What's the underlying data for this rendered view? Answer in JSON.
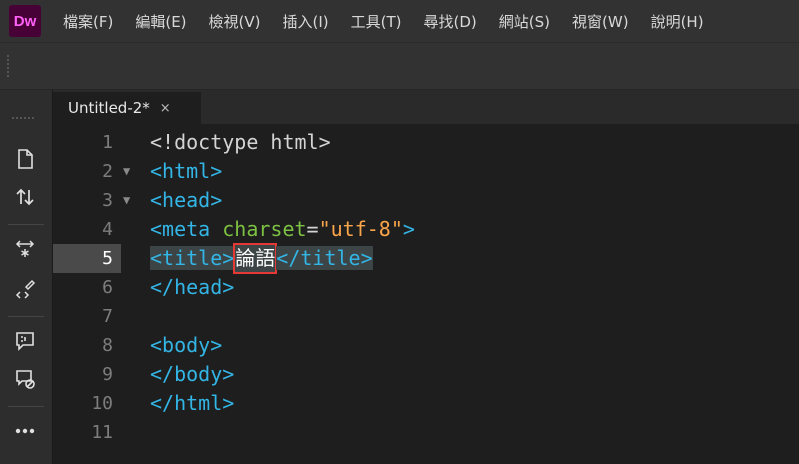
{
  "app": {
    "logo_text": "Dw",
    "logo_bg": "#470137",
    "logo_fg": "#ff61f6"
  },
  "menu": [
    "檔案(F)",
    "編輯(E)",
    "檢視(V)",
    "插入(I)",
    "工具(T)",
    "尋找(D)",
    "網站(S)",
    "視窗(W)",
    "說明(H)"
  ],
  "left_toolbar": {
    "icons": [
      "file-icon",
      "sort-arrows-icon",
      "expand-collapse-icon",
      "format-source-icon",
      "comment-icon",
      "remove-comment-icon",
      "more-icon"
    ]
  },
  "tab": {
    "title": "Untitled-2*",
    "close": "×"
  },
  "editor": {
    "active_line": 5,
    "line_numbers": [
      "1",
      "2",
      "3",
      "4",
      "5",
      "6",
      "7",
      "8",
      "9",
      "10",
      "11"
    ],
    "folds": [
      "",
      "▼",
      "▼",
      "",
      "",
      "",
      "",
      "",
      "",
      "",
      ""
    ],
    "lines": {
      "l1": "<!doctype html>",
      "l2": "<html>",
      "l3": "<head>",
      "l4_tag_open": "<meta ",
      "l4_attr": "charset",
      "l4_eq": "=",
      "l4_val": "\"utf-8\"",
      "l4_tag_close": ">",
      "l5_open": "<title>",
      "l5_text": "論語",
      "l5_close": "</title>",
      "l6": "</head>",
      "l8": "<body>",
      "l9": "</body>",
      "l10": "</html>"
    }
  },
  "colors": {
    "tag": "#33b5e5",
    "attribute": "#7cc142",
    "string": "#f9a54a",
    "highlight_box": "#e53935"
  }
}
